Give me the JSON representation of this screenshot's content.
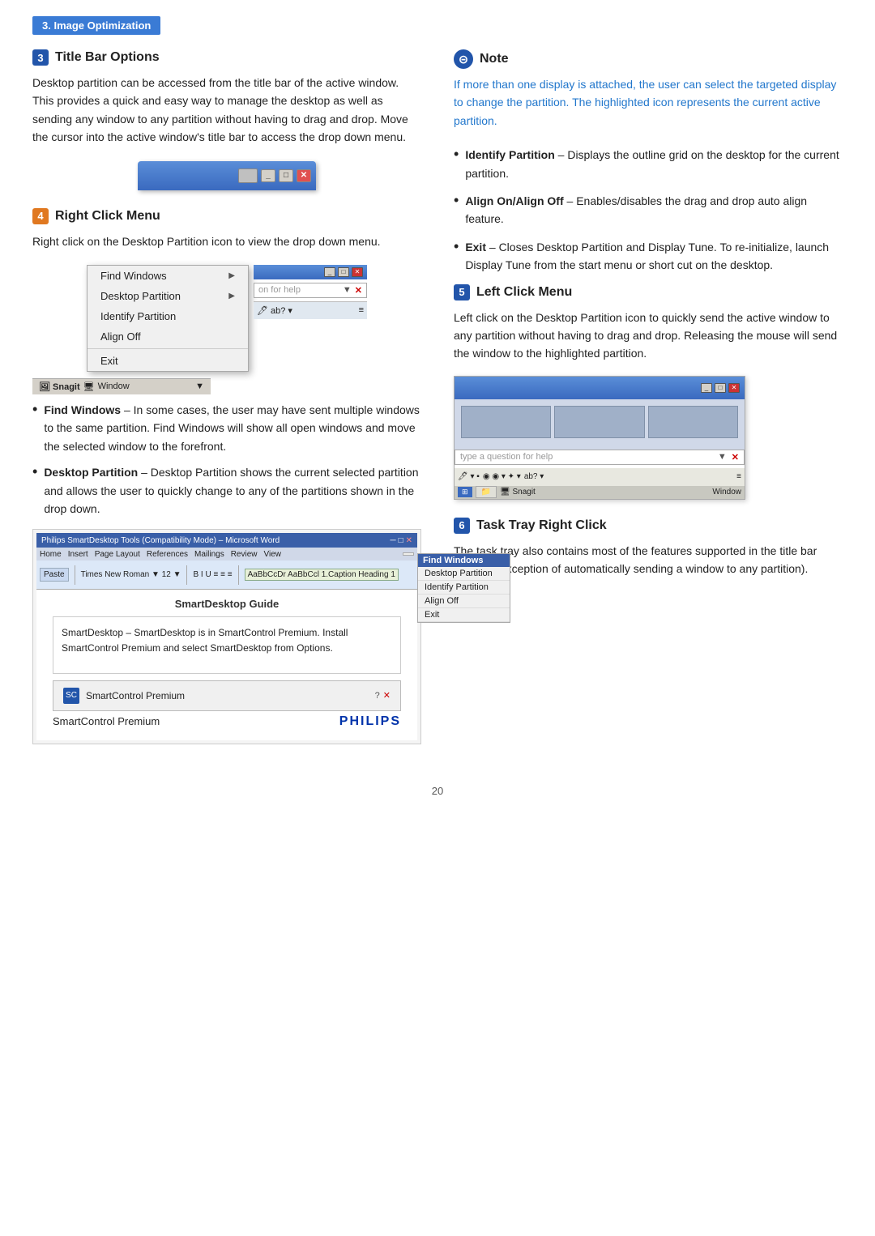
{
  "page": {
    "tag": "3. Image Optimization",
    "footer_page": "20"
  },
  "left": {
    "section3": {
      "num": "3",
      "title": "Title Bar Options",
      "body": "Desktop partition can be accessed from the title bar of the active window. This provides a quick and easy way to manage the desktop as well as sending any window to any partition without having to drag and drop. Move the cursor into the active window's title bar to access the drop down menu."
    },
    "section4": {
      "num": "4",
      "title": "Right Click Menu",
      "body": "Right click on the Desktop Partition icon to view the drop down menu.",
      "menu_items": [
        {
          "label": "Find Windows",
          "has_arrow": true
        },
        {
          "label": "Desktop Partition",
          "has_arrow": true
        },
        {
          "label": "Identify Partition",
          "has_arrow": false
        },
        {
          "label": "Align Off",
          "has_arrow": false
        },
        {
          "label": "Exit",
          "has_arrow": false
        }
      ]
    },
    "bullets": [
      {
        "term": "Find Windows",
        "desc": "– In some cases, the user may have sent multiple windows to the same partition. Find Windows will show all open windows and move the selected window to the forefront."
      },
      {
        "term": "Desktop Partition",
        "desc": "– Desktop Partition shows the current selected partition and allows the user to quickly change to any of the partitions shown in the drop down."
      }
    ],
    "screenshot_label": "SmartDesktop Guide",
    "smartdesktop_note": "SmartDesktop – SmartDesktop is in SmartControl Premium. Install SmartControl Premium and select SmartDesktop from Options.",
    "smartcontrol_label": "SmartControl Premium",
    "philips_label": "PHILIPS",
    "smartcontrol_brand": "SmartControl Premium"
  },
  "right": {
    "note": {
      "title": "Note",
      "text": "If more than one display is attached, the user can select the targeted display to change the partition. The highlighted icon represents the current active partition."
    },
    "note_bullets": [
      {
        "term": "Identify Partition",
        "desc": "– Displays the outline grid on the desktop for the current partition."
      },
      {
        "term": "Align On/Align Off",
        "desc": "– Enables/disables the drag and drop auto align feature."
      },
      {
        "term": "Exit",
        "desc": "– Closes Desktop Partition and Display Tune. To re-initialize, launch Display Tune from the start menu or short cut on the desktop."
      }
    ],
    "section5": {
      "num": "5",
      "title": "Left Click Menu",
      "body": "Left click on the Desktop Partition icon to quickly send the active window to any partition without having to drag and drop. Releasing the mouse will send the window to the highlighted partition."
    },
    "section6": {
      "num": "6",
      "title": "Task Tray Right Click",
      "body": "The task tray also contains most of the features supported in the title bar (with the exception of automatically sending a window to any partition)."
    },
    "search_placeholder": "type a question for help",
    "lc_panels": [
      "panel1",
      "panel2",
      "panel3"
    ]
  },
  "icons": {
    "note_icon": "⊝",
    "arrow_right": "▶",
    "minimize": "_",
    "maximize": "□",
    "close": "✕"
  }
}
